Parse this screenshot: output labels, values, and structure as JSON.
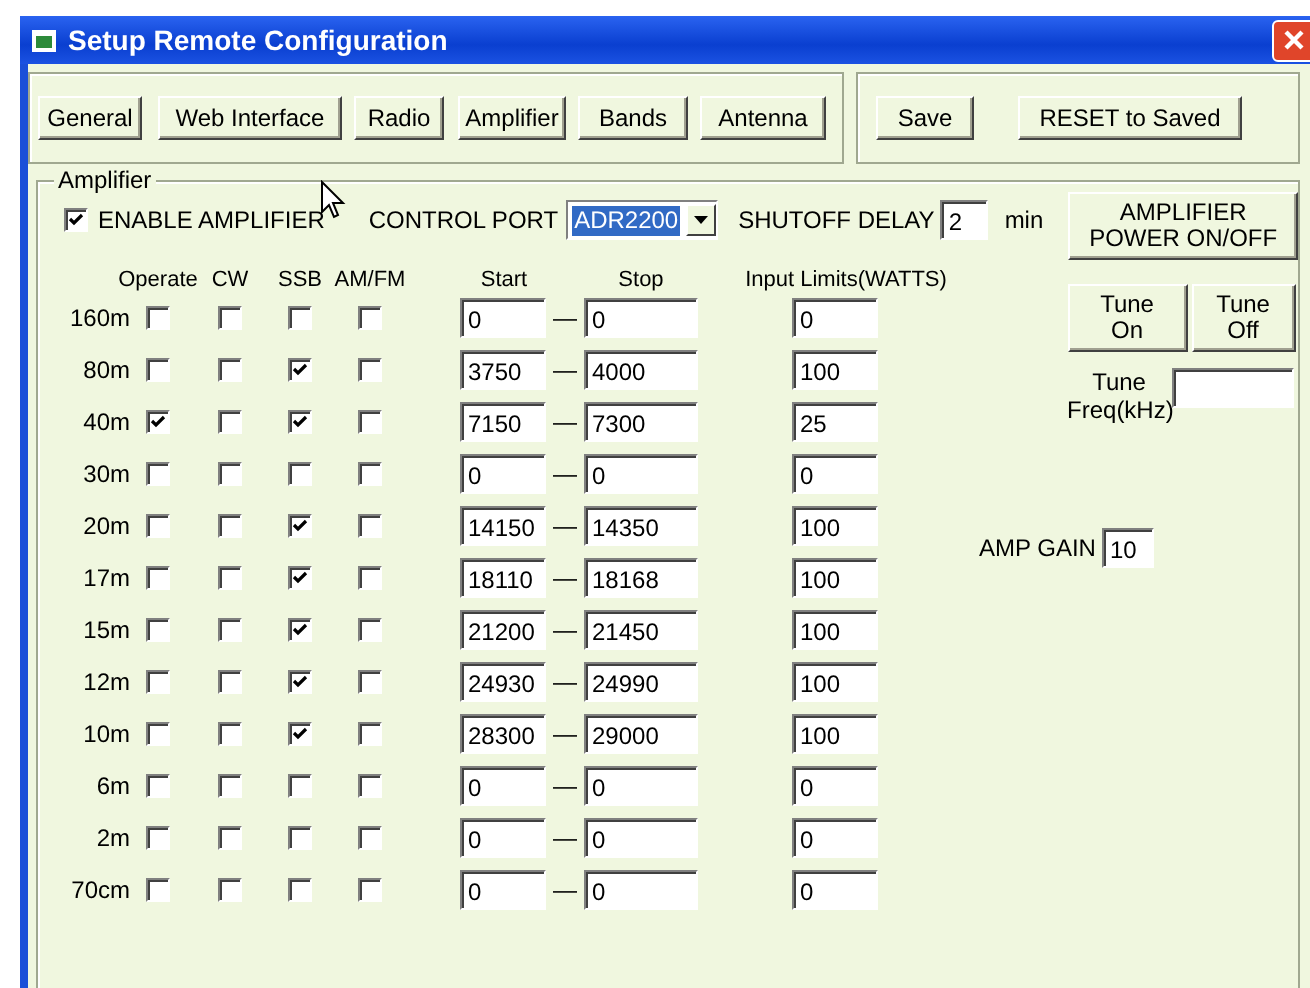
{
  "window": {
    "title": "Setup Remote Configuration"
  },
  "nav_buttons": [
    "General",
    "Web Interface",
    "Radio",
    "Amplifier",
    "Bands",
    "Antenna"
  ],
  "action_buttons": [
    "Save",
    "RESET to Saved"
  ],
  "amplifier": {
    "group_label": "Amplifier",
    "enable": {
      "label": "ENABLE AMPLIFIER",
      "checked": true
    },
    "control_port": {
      "label": "CONTROL PORT",
      "value": "ADR2200"
    },
    "shutoff_delay": {
      "label": "SHUTOFF DELAY",
      "value": "2",
      "unit": "min"
    },
    "columns": [
      "Operate",
      "CW",
      "SSB",
      "AM/FM",
      "Start",
      "Stop",
      "Input Limits(WATTS)"
    ],
    "separator": "—",
    "bands": [
      {
        "name": "160m",
        "operate": false,
        "cw": false,
        "ssb": false,
        "amfm": false,
        "start": "0",
        "stop": "0",
        "limit": "0"
      },
      {
        "name": "80m",
        "operate": false,
        "cw": false,
        "ssb": true,
        "amfm": false,
        "start": "3750",
        "stop": "4000",
        "limit": "100"
      },
      {
        "name": "40m",
        "operate": true,
        "cw": false,
        "ssb": true,
        "amfm": false,
        "start": "7150",
        "stop": "7300",
        "limit": "25"
      },
      {
        "name": "30m",
        "operate": false,
        "cw": false,
        "ssb": false,
        "amfm": false,
        "start": "0",
        "stop": "0",
        "limit": "0"
      },
      {
        "name": "20m",
        "operate": false,
        "cw": false,
        "ssb": true,
        "amfm": false,
        "start": "14150",
        "stop": "14350",
        "limit": "100"
      },
      {
        "name": "17m",
        "operate": false,
        "cw": false,
        "ssb": true,
        "amfm": false,
        "start": "18110",
        "stop": "18168",
        "limit": "100"
      },
      {
        "name": "15m",
        "operate": false,
        "cw": false,
        "ssb": true,
        "amfm": false,
        "start": "21200",
        "stop": "21450",
        "limit": "100"
      },
      {
        "name": "12m",
        "operate": false,
        "cw": false,
        "ssb": true,
        "amfm": false,
        "start": "24930",
        "stop": "24990",
        "limit": "100"
      },
      {
        "name": "10m",
        "operate": false,
        "cw": false,
        "ssb": true,
        "amfm": false,
        "start": "28300",
        "stop": "29000",
        "limit": "100"
      },
      {
        "name": "6m",
        "operate": false,
        "cw": false,
        "ssb": false,
        "amfm": false,
        "start": "0",
        "stop": "0",
        "limit": "0"
      },
      {
        "name": "2m",
        "operate": false,
        "cw": false,
        "ssb": false,
        "amfm": false,
        "start": "0",
        "stop": "0",
        "limit": "0"
      },
      {
        "name": "70cm",
        "operate": false,
        "cw": false,
        "ssb": false,
        "amfm": false,
        "start": "0",
        "stop": "0",
        "limit": "0"
      }
    ],
    "power_button": [
      "AMPLIFIER",
      "POWER ON/OFF"
    ],
    "tune_buttons": [
      [
        "Tune",
        "On"
      ],
      [
        "Tune",
        "Off"
      ]
    ],
    "tune_freq": {
      "label": [
        "Tune",
        "Freq(kHz)"
      ]
    },
    "amp_gain": {
      "label": "AMP GAIN",
      "value": "10"
    }
  }
}
